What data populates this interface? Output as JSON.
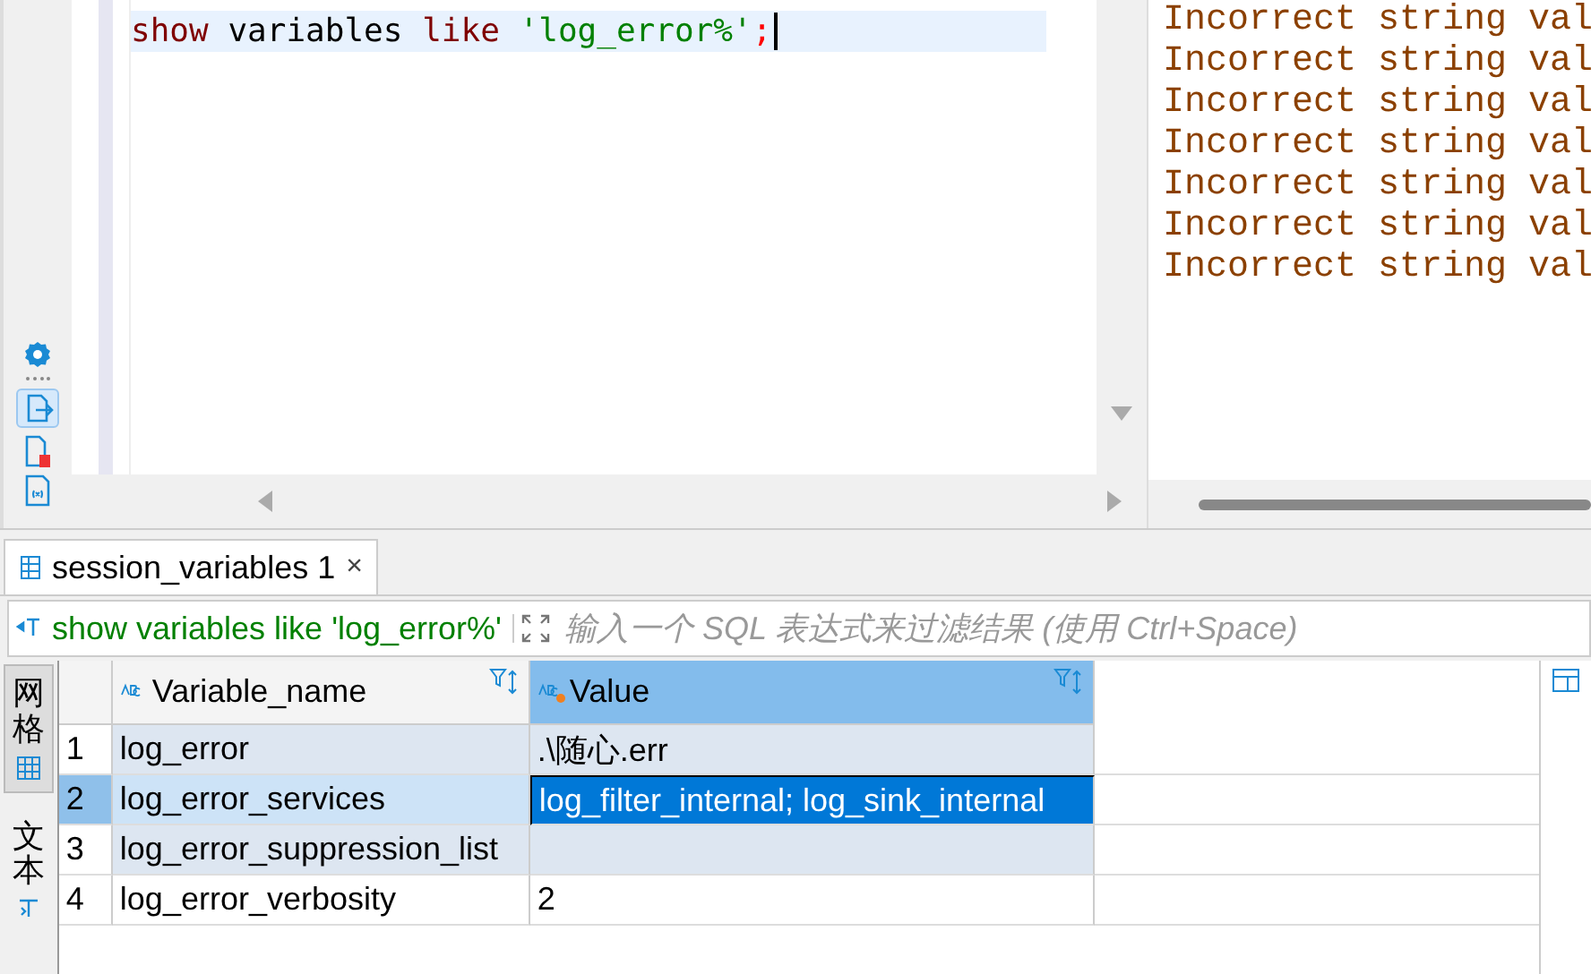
{
  "editor": {
    "lines": [
      {
        "tokens": [
          {
            "kind": "keyword",
            "text": "show"
          },
          {
            "kind": "plain",
            "text": " variables "
          },
          {
            "kind": "keyword",
            "text": "like"
          },
          {
            "kind": "string",
            "text": " 'log_error%'"
          },
          {
            "kind": "punct",
            "text": ";"
          }
        ],
        "current": true
      }
    ]
  },
  "console": {
    "lines": [
      "Incorrect string val",
      "Incorrect string val",
      "Incorrect string val",
      "Incorrect string val",
      "Incorrect string val",
      "Incorrect string val",
      "Incorrect string val"
    ]
  },
  "result_tab": {
    "label": "session_variables 1",
    "close": "×",
    "selected": true
  },
  "filter": {
    "query": "show variables like 'log_error%'",
    "placeholder": "输入一个 SQL 表达式来过滤结果 (使用 Ctrl+Space)"
  },
  "view_tabs": [
    {
      "label": "网格",
      "selected": true
    },
    {
      "label": "文本",
      "selected": false
    }
  ],
  "table": {
    "columns": [
      {
        "label": "Variable_name",
        "selected": false
      },
      {
        "label": "Value",
        "selected": true
      }
    ],
    "rows": [
      {
        "number": "1",
        "cells": [
          "log_error",
          ".\\随心.err"
        ],
        "highlighted": true,
        "selected": false
      },
      {
        "number": "2",
        "cells": [
          "log_error_services",
          "log_filter_internal; log_sink_internal"
        ],
        "highlighted": true,
        "selected": true
      },
      {
        "number": "3",
        "cells": [
          "log_error_suppression_list",
          ""
        ],
        "highlighted": true,
        "selected": false
      },
      {
        "number": "4",
        "cells": [
          "log_error_verbosity",
          "2"
        ],
        "highlighted": false,
        "selected": false
      }
    ]
  }
}
